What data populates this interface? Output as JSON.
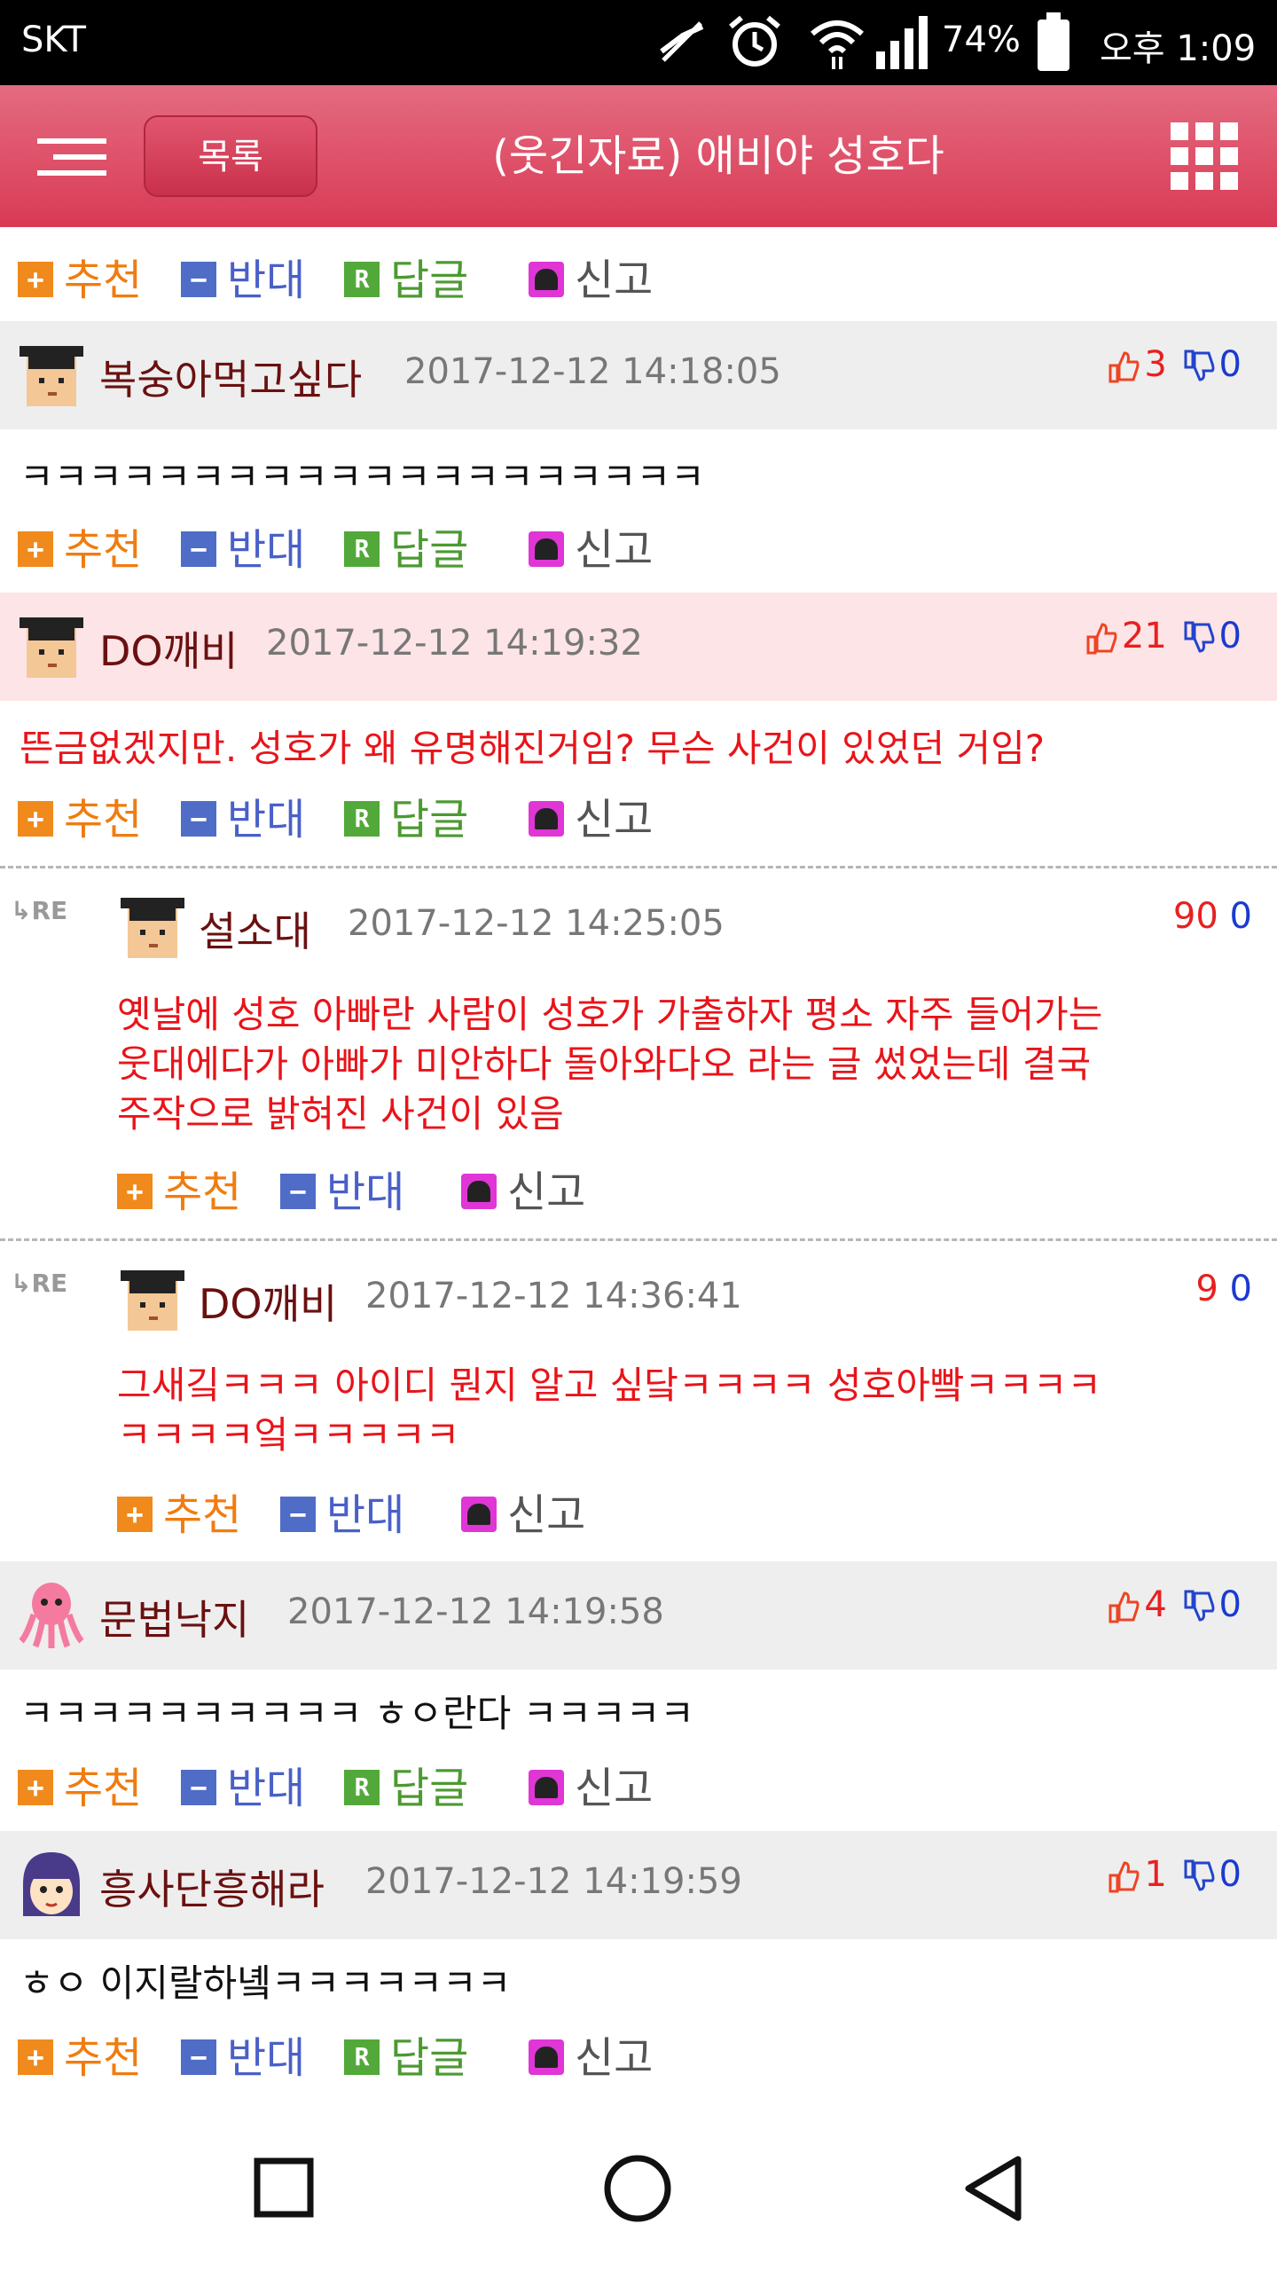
{
  "status_bar": {
    "carrier": "SKT",
    "battery": "74%",
    "time": "오후 1:09"
  },
  "header": {
    "list_button": "목록",
    "title": "(웃긴자료) 애비야 성호다"
  },
  "actions": {
    "recommend": "추천",
    "oppose": "반대",
    "reply": "답글",
    "report": "신고",
    "reply_icon": "R"
  },
  "comments": [
    {
      "nick": "복숭아먹고싶다",
      "date": "2017-12-12 14:18:05",
      "likes": "3",
      "dislikes": "0",
      "text": "ㅋㅋㅋㅋㅋㅋㅋㅋㅋㅋㅋㅋㅋㅋㅋㅋㅋㅋㅋㅋ"
    },
    {
      "nick": "DO깨비",
      "date": "2017-12-12 14:19:32",
      "likes": "21",
      "dislikes": "0",
      "text": "뜬금없겠지만. 성호가 왜 유명해진거임? 무슨 사건이 있었던 거임?"
    },
    {
      "re_label": "RE",
      "nick": "설소대",
      "date": "2017-12-12 14:25:05",
      "likes": "90",
      "dislikes": "0",
      "lines": [
        "옛날에 성호 아빠란 사람이 성호가 가출하자 평소 자주 들어가는",
        "웃대에다가 아빠가 미안하다 돌아와다오 라는 글 썼었는데 결국",
        "주작으로 밝혀진 사건이 있음"
      ]
    },
    {
      "re_label": "RE",
      "nick": "DO깨비",
      "date": "2017-12-12 14:36:41",
      "likes": "9",
      "dislikes": "0",
      "lines": [
        "그새깈ㅋㅋㅋ 아이디 뭔지 알고 싶닼ㅋㅋㅋㅋ 성호아빸ㅋㅋㅋㅋ",
        "ㅋㅋㅋㅋ엌ㅋㅋㅋㅋㅋ"
      ]
    },
    {
      "nick": "문법낙지",
      "date": "2017-12-12 14:19:58",
      "likes": "4",
      "dislikes": "0",
      "text": "ㅋㅋㅋㅋㅋㅋㅋㅋㅋㅋ ㅎㅇ란다 ㅋㅋㅋㅋㅋ"
    },
    {
      "nick": "흥사단흥해라",
      "date": "2017-12-12 14:19:59",
      "likes": "1",
      "dislikes": "0",
      "text": "ㅎㅇ 이지랄하녴ㅋㅋㅋㅋㅋㅋㅋ"
    }
  ],
  "colors": {
    "header": "#d93a55",
    "highlight_row": "#fde4e6",
    "gray_row": "#eeeeee"
  }
}
